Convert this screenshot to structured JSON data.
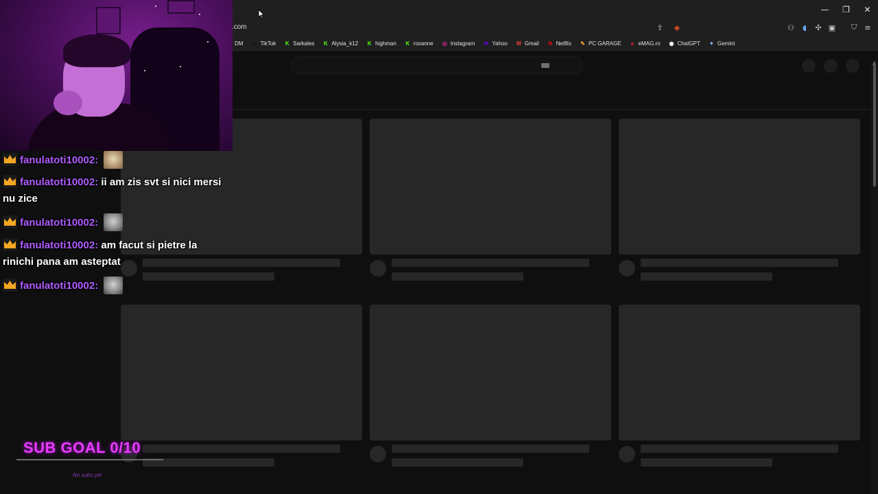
{
  "browser": {
    "url": ".com",
    "window_controls": {
      "minimize": "—",
      "restore": "❐",
      "close": "✕"
    },
    "toolbar_icons": [
      "share-icon",
      "brave-shield-icon",
      "extension-icon",
      "puzzle-icon",
      "sidebar-icon",
      "wallet-icon",
      "menu-icon"
    ],
    "bookmarks": [
      {
        "label": "DM",
        "icon": "",
        "color": "#1f1f1f"
      },
      {
        "label": "TikTok",
        "icon": "♪",
        "color": "#000000"
      },
      {
        "label": "Sarkales",
        "icon": "K",
        "color": "#53fc18"
      },
      {
        "label": "Alysia_k12",
        "icon": "K",
        "color": "#53fc18"
      },
      {
        "label": "highman",
        "icon": "K",
        "color": "#53fc18"
      },
      {
        "label": "roxanne",
        "icon": "K",
        "color": "#53fc18"
      },
      {
        "label": "Instagram",
        "icon": "◎",
        "color": "#d6249f"
      },
      {
        "label": "Yahoo",
        "icon": "✉",
        "color": "#6001d2"
      },
      {
        "label": "Gmail",
        "icon": "M",
        "color": "#ea4335"
      },
      {
        "label": "Netflix",
        "icon": "N",
        "color": "#e50914"
      },
      {
        "label": "PC GARAGE",
        "icon": "✎",
        "color": "#f0a030"
      },
      {
        "label": "eMAG.ro",
        "icon": "e",
        "color": "#e3262f"
      },
      {
        "label": "ChatGPT",
        "icon": "◉",
        "color": "#ffffff"
      },
      {
        "label": "Gemini",
        "icon": "✦",
        "color": "#8ab4f8"
      }
    ]
  },
  "chat": {
    "messages": [
      {
        "user": "fanulatoti10002:",
        "text": "",
        "emote": "cat"
      },
      {
        "user": "fanulatoti10002:",
        "text": "ii am zis svt si nici mersi nu zice",
        "emote": ""
      },
      {
        "user": "fanulatoti10002:",
        "text": "",
        "emote": "face"
      },
      {
        "user": "fanulatoti10002:",
        "text": "am facut si pietre la rinichi pana am asteptat",
        "emote": ""
      },
      {
        "user": "fanulatoti10002:",
        "text": "",
        "emote": "face"
      }
    ]
  },
  "sub_goal": {
    "title": "SUB GOAL 0/10",
    "note": "No subs yet",
    "progress": 0
  }
}
